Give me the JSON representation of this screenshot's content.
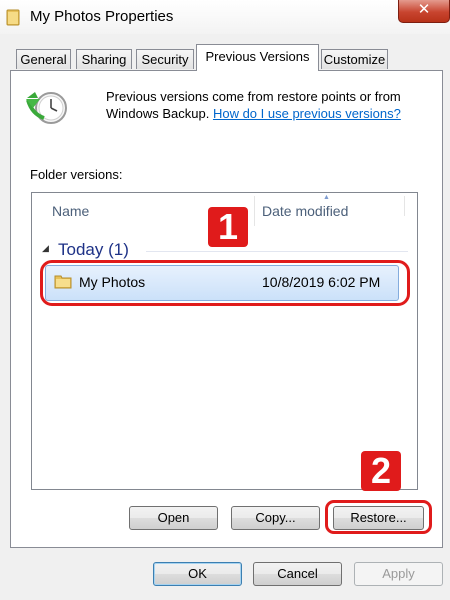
{
  "window": {
    "title": "My Photos Properties",
    "close_glyph": "✕"
  },
  "tabs": [
    {
      "label": "General"
    },
    {
      "label": "Sharing"
    },
    {
      "label": "Security"
    },
    {
      "label": "Previous Versions"
    },
    {
      "label": "Customize"
    }
  ],
  "active_tab": "Previous Versions",
  "info": {
    "line1": "Previous versions come from restore points or from",
    "line2_prefix": "Windows Backup.",
    "link": "How do I use previous versions?"
  },
  "folder_versions_label": "Folder versions:",
  "list": {
    "columns": {
      "name": "Name",
      "date": "Date modified"
    },
    "group": {
      "label": "Today (1)"
    },
    "rows": [
      {
        "name": "My Photos",
        "date": "10/8/2019 6:02 PM"
      }
    ]
  },
  "annotations": {
    "badge1": "1",
    "badge2": "2",
    "color": "#e01b1b"
  },
  "actions": {
    "open": "Open",
    "copy": "Copy...",
    "restore": "Restore..."
  },
  "dialog_buttons": {
    "ok": "OK",
    "cancel": "Cancel",
    "apply": "Apply"
  },
  "icons": {
    "title": "folder-icon",
    "info": "clock-restore-icon",
    "row": "folder-icon"
  }
}
